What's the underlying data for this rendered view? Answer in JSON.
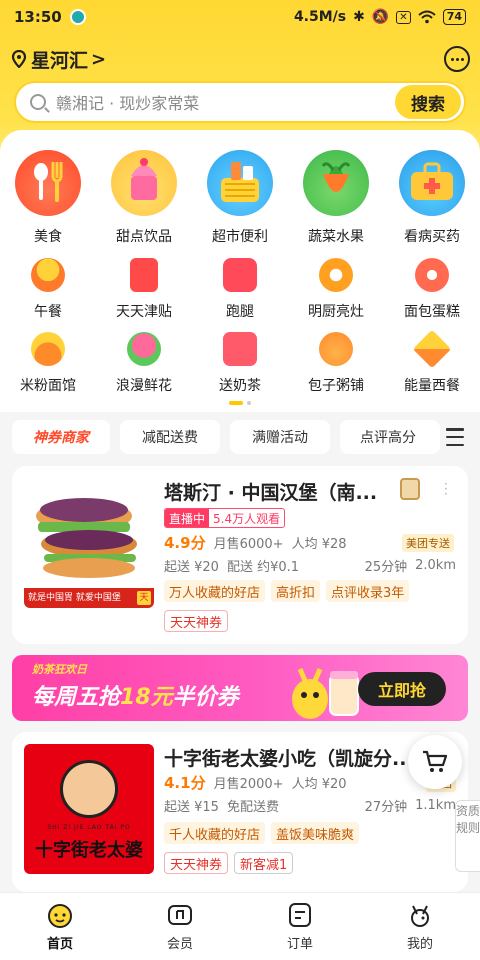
{
  "status": {
    "time": "13:50",
    "net_speed": "4.5M/s",
    "battery": "74"
  },
  "header": {
    "location": "星河汇",
    "chevron": ">"
  },
  "search": {
    "placeholder": "赣湘记 · 现炒家常菜",
    "button": "搜索"
  },
  "big_categories": [
    {
      "label": "美食",
      "icon": "cutlery-icon",
      "color": "#ff5a3c"
    },
    {
      "label": "甜点饮品",
      "icon": "icecream-icon",
      "color": "#ff7aa8"
    },
    {
      "label": "超市便利",
      "icon": "basket-icon",
      "color": "#3cb8ff"
    },
    {
      "label": "蔬菜水果",
      "icon": "carrot-icon",
      "color": "#ff7a2a"
    },
    {
      "label": "看病买药",
      "icon": "medkit-icon",
      "color": "#ffb020"
    }
  ],
  "small_row_1": [
    {
      "label": "午餐",
      "icon": "bowl-icon",
      "color": "#ff8a2a"
    },
    {
      "label": "天天津贴",
      "icon": "coupon-icon",
      "color": "#ff4a4a"
    },
    {
      "label": "跑腿",
      "icon": "runner-icon",
      "color": "#ff4a5a"
    },
    {
      "label": "明厨亮灶",
      "icon": "camera-icon",
      "color": "#ffa020"
    },
    {
      "label": "面包蛋糕",
      "icon": "cake-icon",
      "color": "#ff6a50"
    }
  ],
  "small_row_2": [
    {
      "label": "米粉面馆",
      "icon": "noodle-icon",
      "color": "#ff9a2a"
    },
    {
      "label": "浪漫鲜花",
      "icon": "flower-icon",
      "color": "#ff6a9a"
    },
    {
      "label": "送奶茶",
      "icon": "gift-icon",
      "color": "#ff5a6a"
    },
    {
      "label": "包子粥铺",
      "icon": "bun-icon",
      "color": "#ff9a3a"
    },
    {
      "label": "能量西餐",
      "icon": "pizza-icon",
      "color": "#ffa030"
    }
  ],
  "filters": [
    "神券商家",
    "减配送费",
    "满赠活动",
    "点评高分"
  ],
  "shop1": {
    "name": "塔斯汀 · 中国汉堡（南...",
    "live_label": "直播中",
    "live_viewers": "5.4万人观看",
    "score": "4.9分",
    "monthly": "月售6000+",
    "avg": "人均 ¥28",
    "delivery_badge": "美团专送",
    "min_order": "起送 ¥20",
    "fee": "配送 约¥0.1",
    "time": "25分钟",
    "distance": "2.0km",
    "tags": [
      "万人收藏的好店",
      "高折扣",
      "点评收录3年"
    ],
    "coupon": "天天神券",
    "thumb_caption": "就是中国胃 就爱中国堡",
    "thumb_logo": "天"
  },
  "banner": {
    "tag": "奶茶狂欢日",
    "text_a": "每周五抢",
    "text_b": "18元",
    "text_c": "半价券",
    "button": "立即抢"
  },
  "shop2": {
    "name": "十字街老太婆小吃（凯旋分...",
    "score": "4.1分",
    "monthly": "月售2000+",
    "avg": "人均 ¥20",
    "delivery_badge": "美团",
    "min_order": "起送 ¥15",
    "fee": "免配送费",
    "time": "27分钟",
    "distance": "1.1km",
    "tags": [
      "千人收藏的好店",
      "盖饭美味脆爽"
    ],
    "coupons": [
      "天天神券",
      "新客减1"
    ],
    "logo_pinyin": "SHI ZI JIE LAO TAI PO",
    "logo_text": "十字街老太婆"
  },
  "report_label": "资质规则",
  "tabbar": [
    {
      "label": "首页",
      "icon": "home-icon"
    },
    {
      "label": "会员",
      "icon": "member-icon"
    },
    {
      "label": "订单",
      "icon": "order-icon"
    },
    {
      "label": "我的",
      "icon": "profile-icon"
    }
  ]
}
